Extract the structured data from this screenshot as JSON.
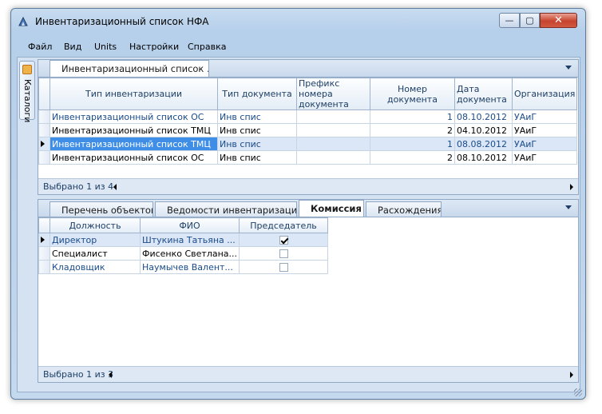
{
  "window": {
    "title": "Инвентаризационный список НФА",
    "min_label": "—",
    "max_label": "▢",
    "close_label": "✕"
  },
  "menu": [
    "Файл",
    "Вид",
    "Units",
    "Настройки",
    "Справка"
  ],
  "sidebar": {
    "tab_label": "Каталоги"
  },
  "top_panel": {
    "tab_label": "Инвентаризационный список ...",
    "columns": [
      "Тип инвентаризации",
      "Тип документа",
      "Префикс номера документа",
      "Номер документа",
      "Дата документа",
      "Организация"
    ],
    "rows": [
      {
        "type": "Инвентаризационный список ОС",
        "doc_type": "Инв спис",
        "prefix": "",
        "number": "1",
        "date": "08.10.2012",
        "org": "УАиГ"
      },
      {
        "type": "Инвентаризационный список ТМЦ",
        "doc_type": "Инв спис",
        "prefix": "",
        "number": "2",
        "date": "04.10.2012",
        "org": "УАиГ"
      },
      {
        "type": "Инвентаризационный список ТМЦ",
        "doc_type": "Инв спис",
        "prefix": "",
        "number": "1",
        "date": "08.08.2012",
        "org": "УАиГ"
      },
      {
        "type": "Инвентаризационный список ОС",
        "doc_type": "Инв спис",
        "prefix": "",
        "number": "2",
        "date": "08.10.2012",
        "org": "УАиГ"
      }
    ],
    "status": "Выбрано 1 из 4"
  },
  "bottom_panel": {
    "tabs": [
      "Перечень объектов",
      "Ведомости инвентаризации",
      "Комиссия",
      "Расхождения"
    ],
    "active_tab": "Комиссия",
    "columns": [
      "Должность",
      "ФИО",
      "Председатель"
    ],
    "rows": [
      {
        "position": "Директор",
        "name": "Штукина Татьяна ...",
        "chairman": true
      },
      {
        "position": "Специалист",
        "name": "Фисенко Светлана...",
        "chairman": false
      },
      {
        "position": "Кладовщик",
        "name": "Наумычев Валент...",
        "chairman": false
      }
    ],
    "status": "Выбрано 1 из 3"
  },
  "colors": {
    "selection": "#3e8ee8",
    "link_text": "#1a4b8a",
    "header_text": "#1e3f66"
  }
}
